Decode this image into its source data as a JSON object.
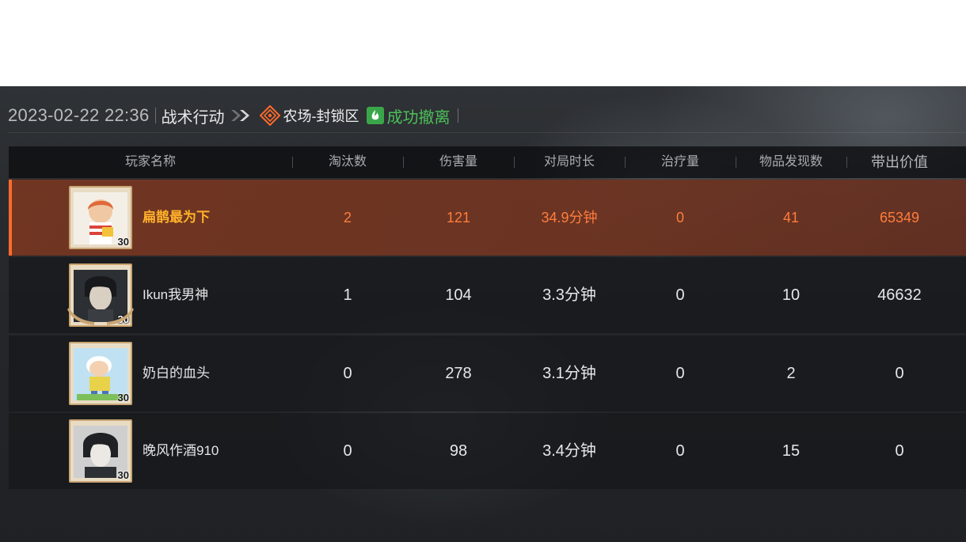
{
  "header": {
    "datetime": "2023-02-22 22:36",
    "mode": "战术行动",
    "map": "农场-封锁区",
    "status": "成功撤离"
  },
  "columns": {
    "player": "玩家名称",
    "kills": "淘汰数",
    "damage": "伤害量",
    "duration": "对局时长",
    "healing": "治疗量",
    "items": "物品发现数",
    "value": "带出价值"
  },
  "rows": [
    {
      "name": "扁鹊最为下",
      "level": "30",
      "kills": "2",
      "damage": "121",
      "duration": "34.9分钟",
      "healing": "0",
      "items": "41",
      "value": "65349",
      "highlight": true
    },
    {
      "name": "Ikun我男神",
      "level": "30",
      "kills": "1",
      "damage": "104",
      "duration": "3.3分钟",
      "healing": "0",
      "items": "10",
      "value": "46632"
    },
    {
      "name": "奶白的血头",
      "level": "30",
      "kills": "0",
      "damage": "278",
      "duration": "3.1分钟",
      "healing": "0",
      "items": "2",
      "value": "0"
    },
    {
      "name": "晚风作酒910",
      "level": "30",
      "kills": "0",
      "damage": "98",
      "duration": "3.4分钟",
      "healing": "0",
      "items": "15",
      "value": "0"
    }
  ],
  "colors": {
    "accent": "#ff6a2b",
    "highlight_name": "#ffb12a",
    "success": "#4cc05a"
  },
  "icons": [
    "chevron-right-double-icon",
    "map-marker-icon",
    "exit-icon",
    "avatar-frame"
  ]
}
